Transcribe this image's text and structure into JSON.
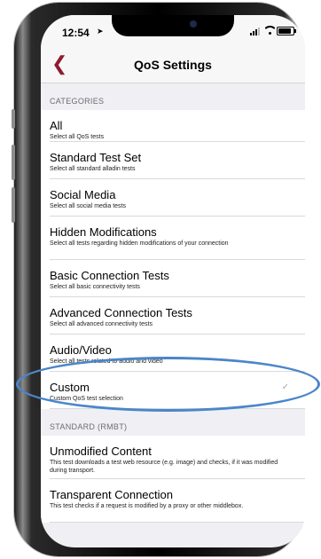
{
  "status_bar": {
    "time": "12:54"
  },
  "nav": {
    "title": "QoS Settings"
  },
  "sections": [
    {
      "header": "CATEGORIES",
      "items": [
        {
          "title": "All",
          "subtitle": "Select all QoS tests"
        },
        {
          "title": "Standard Test Set",
          "subtitle": "Select all standard alladin tests"
        },
        {
          "title": "Social Media",
          "subtitle": "Select all social media tests"
        },
        {
          "title": "Hidden Modifications",
          "subtitle": "Select all tests regarding hidden modifications of your connection"
        },
        {
          "title": "Basic Connection Tests",
          "subtitle": "Select all basic connectivity tests"
        },
        {
          "title": "Advanced Connection Tests",
          "subtitle": "Select all advanced connectivity tests"
        },
        {
          "title": "Audio/Video",
          "subtitle": "Select all tests related to audio and video"
        },
        {
          "title": "Custom",
          "subtitle": "Custom QoS test selection",
          "checked": true,
          "check_glyph": "✓"
        }
      ]
    },
    {
      "header": "STANDARD (RMBT)",
      "items": [
        {
          "title": "Unmodified Content",
          "subtitle": "This test downloads a test web resource (e.g. image) and checks, if it was modified during transport."
        },
        {
          "title": "Transparent Connection",
          "subtitle": "This test checks if a request is modified by a proxy or other middlebox."
        }
      ]
    }
  ],
  "colors": {
    "accent": "#8e1d2f",
    "highlight": "#4a86c9",
    "background": "#efeff4"
  }
}
